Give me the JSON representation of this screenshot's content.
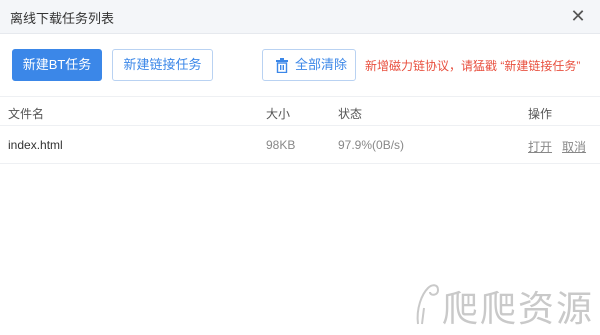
{
  "dialog": {
    "title": "离线下载任务列表",
    "close_glyph": "✕"
  },
  "toolbar": {
    "new_bt_label": "新建BT任务",
    "new_link_label": "新建链接任务",
    "clear_all_label": "全部清除",
    "hint": "新增磁力链协议，请猛戳 “新建链接任务”"
  },
  "table": {
    "headers": {
      "name": "文件名",
      "size": "大小",
      "status": "状态",
      "actions": "操作"
    },
    "rows": [
      {
        "name": "index.html",
        "size": "98KB",
        "status": "97.9%(0B/s)",
        "open": "打开",
        "cancel": "取消"
      }
    ]
  },
  "watermark": {
    "text": "爬爬资源"
  },
  "colors": {
    "accent": "#3b87e8",
    "hint": "#e8503f"
  }
}
